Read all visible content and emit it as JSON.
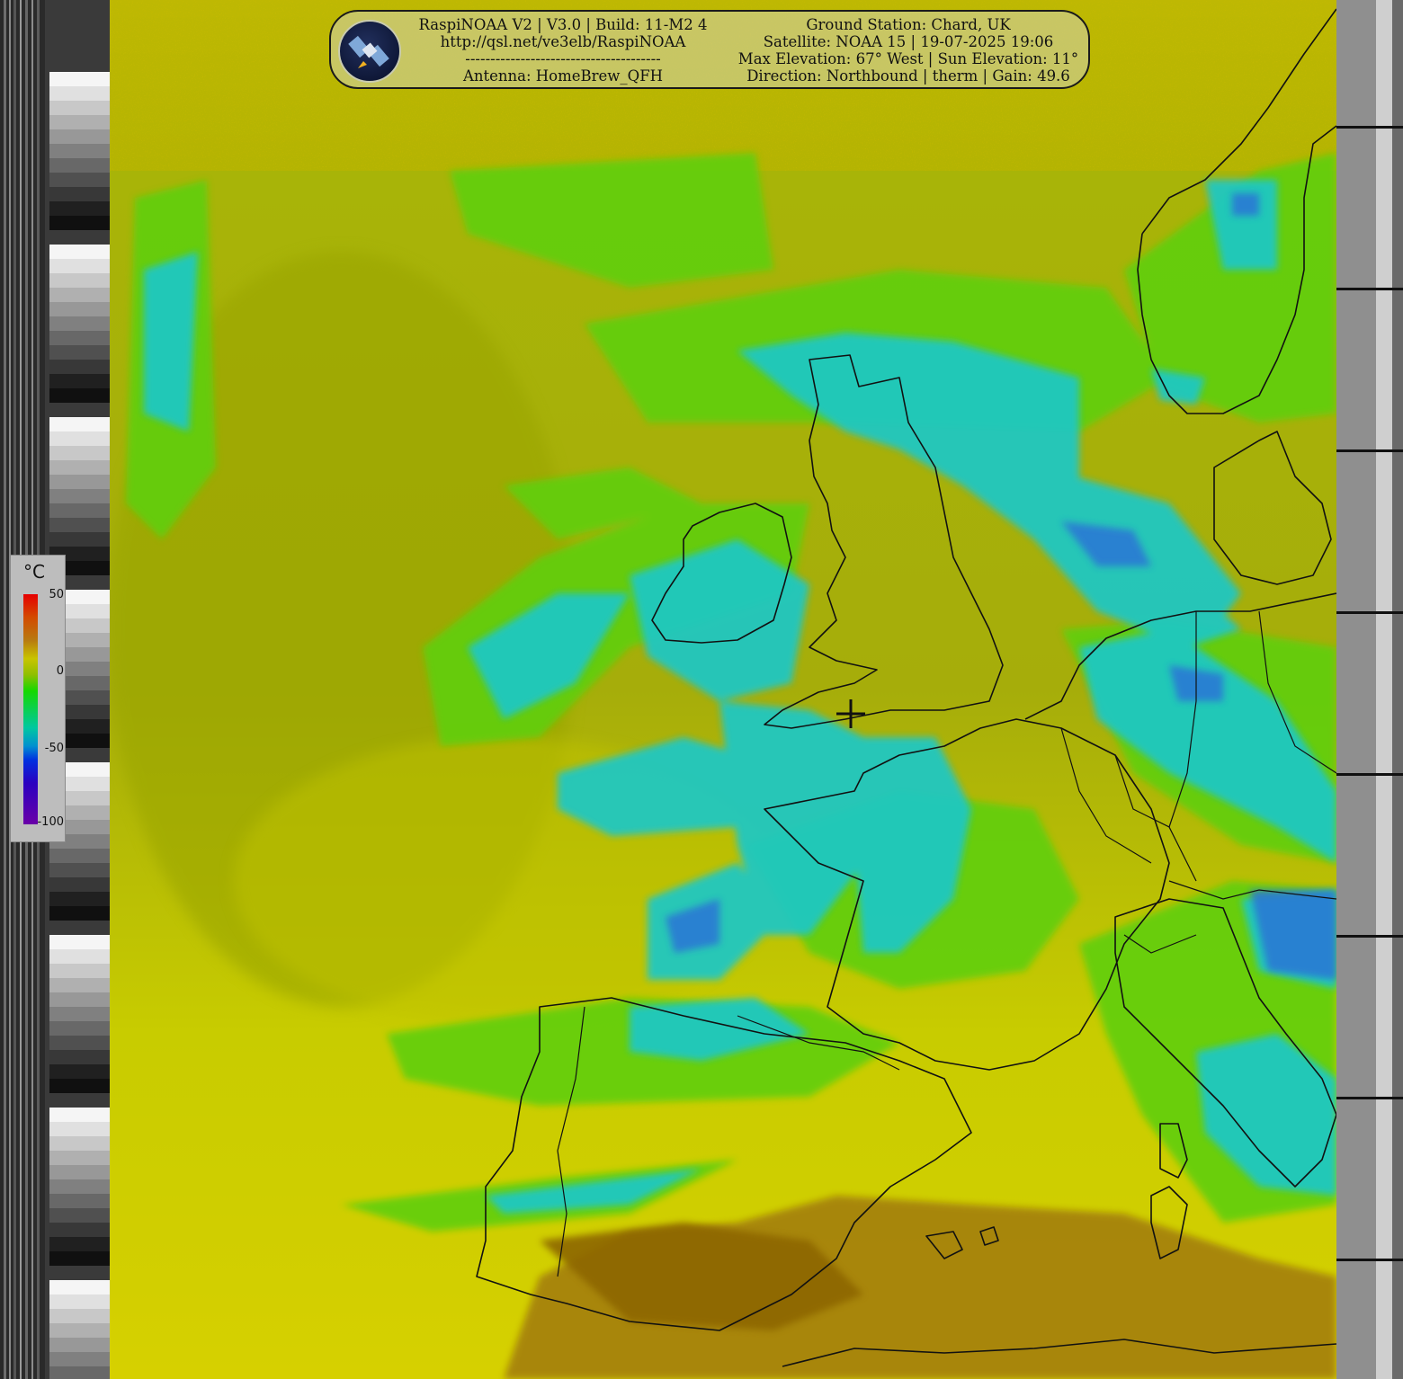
{
  "header": {
    "left_lines": [
      "RaspiNOAA V2 | V3.0 | Build: 11-M2 4",
      "http://qsl.net/ve3elb/RaspiNOAA",
      "---------------------------------------",
      "Antenna: HomeBrew_QFH"
    ],
    "right_lines": [
      "Ground Station: Chard, UK",
      "Satellite: NOAA 15 | 19-07-2025 19:06",
      "Max Elevation: 67° West | Sun Elevation: 11°",
      "Direction: Northbound | therm | Gain: 49.6"
    ]
  },
  "temperature_scale": {
    "unit": "°C",
    "labels": [
      "50",
      "0",
      "-50",
      "-100"
    ]
  },
  "colors": {
    "sea_base": "#b8b800",
    "cloud_green": "#5fd10a",
    "cloud_cyan": "#1cc8c8",
    "cloud_blue": "#2a7ad8",
    "land_brown": "#9a7206",
    "coast_line": "#111111"
  }
}
